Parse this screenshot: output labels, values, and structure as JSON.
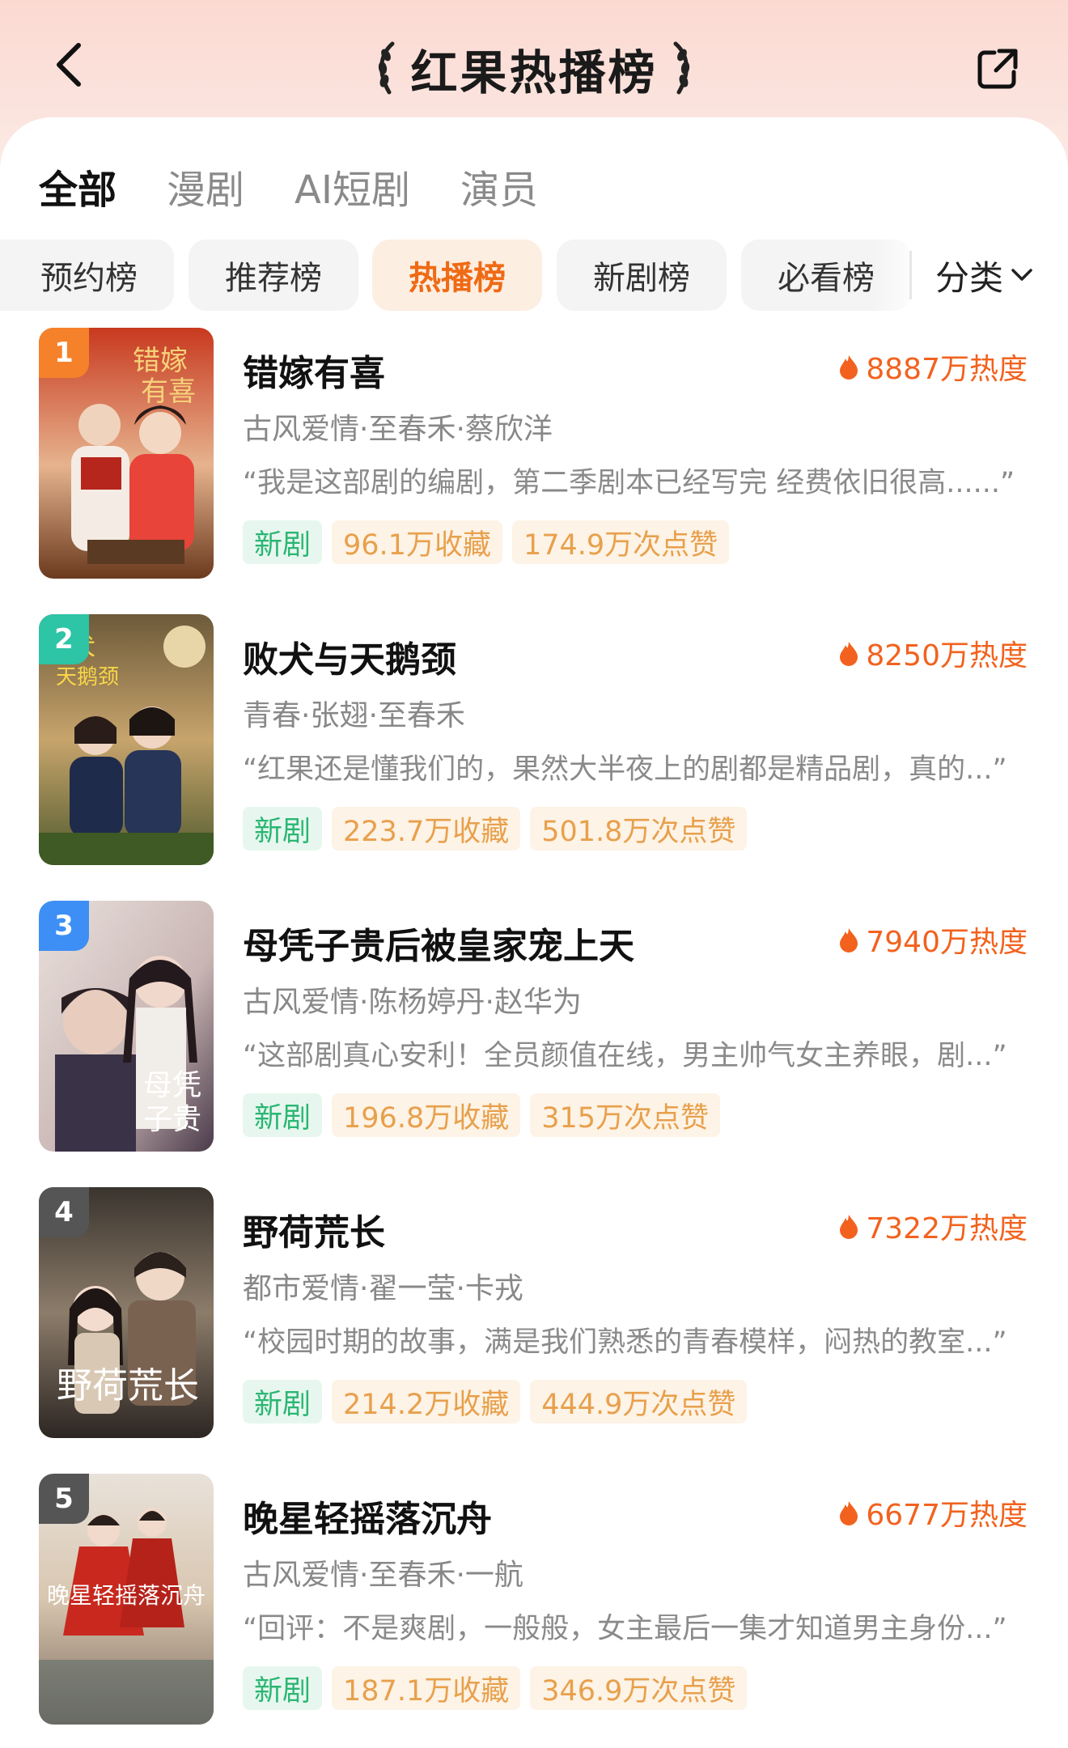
{
  "header": {
    "title": "红果热播榜"
  },
  "tabs": [
    {
      "label": "全部",
      "active": true
    },
    {
      "label": "漫剧",
      "active": false
    },
    {
      "label": "AI短剧",
      "active": false
    },
    {
      "label": "演员",
      "active": false
    }
  ],
  "chips": [
    {
      "label": "预约榜",
      "active": false
    },
    {
      "label": "推荐榜",
      "active": false
    },
    {
      "label": "热播榜",
      "active": true
    },
    {
      "label": "新剧榜",
      "active": false
    },
    {
      "label": "必看榜",
      "active": false
    }
  ],
  "category_label": "分类",
  "colors": {
    "accent": "#f2621e",
    "chip_active_text": "#ef6a14",
    "new_tag": "#2bb673",
    "stat_tag": "#e8a04c",
    "rank_1": "#f5822a",
    "rank_2": "#2ec4a6",
    "rank_3": "#3d8ff5",
    "rank_other": "#555555"
  },
  "items": [
    {
      "rank": "1",
      "title": "错嫁有喜",
      "heat": "8887万热度",
      "meta": "古风爱情·至春禾·蔡欣洋",
      "quote": "“我是这部剧的编剧，第二季剧本已经写完 经费依旧很高......”",
      "tag_new": "新剧",
      "favorites": "96.1万收藏",
      "likes": "174.9万次点赞"
    },
    {
      "rank": "2",
      "title": "败犬与天鹅颈",
      "heat": "8250万热度",
      "meta": "青春·张翅·至春禾",
      "quote": "“红果还是懂我们的，果然大半夜上的剧都是精品剧，真的...”",
      "tag_new": "新剧",
      "favorites": "223.7万收藏",
      "likes": "501.8万次点赞"
    },
    {
      "rank": "3",
      "title": "母凭子贵后被皇家宠上天",
      "heat": "7940万热度",
      "meta": "古风爱情·陈杨婷丹·赵华为",
      "quote": "“这部剧真心安利！全员颜值在线，男主帅气女主养眼，剧...”",
      "tag_new": "新剧",
      "favorites": "196.8万收藏",
      "likes": "315万次点赞"
    },
    {
      "rank": "4",
      "title": "野荷荒长",
      "heat": "7322万热度",
      "meta": "都市爱情·翟一莹·卡戎",
      "quote": "“校园时期的故事，满是我们熟悉的青春模样，闷热的教室...”",
      "tag_new": "新剧",
      "favorites": "214.2万收藏",
      "likes": "444.9万次点赞"
    },
    {
      "rank": "5",
      "title": "晚星轻摇落沉舟",
      "heat": "6677万热度",
      "meta": "古风爱情·至春禾·一航",
      "quote": "“回评：不是爽剧，一般般，女主最后一集才知道男主身份...”",
      "tag_new": "新剧",
      "favorites": "187.1万收藏",
      "likes": "346.9万次点赞"
    }
  ]
}
